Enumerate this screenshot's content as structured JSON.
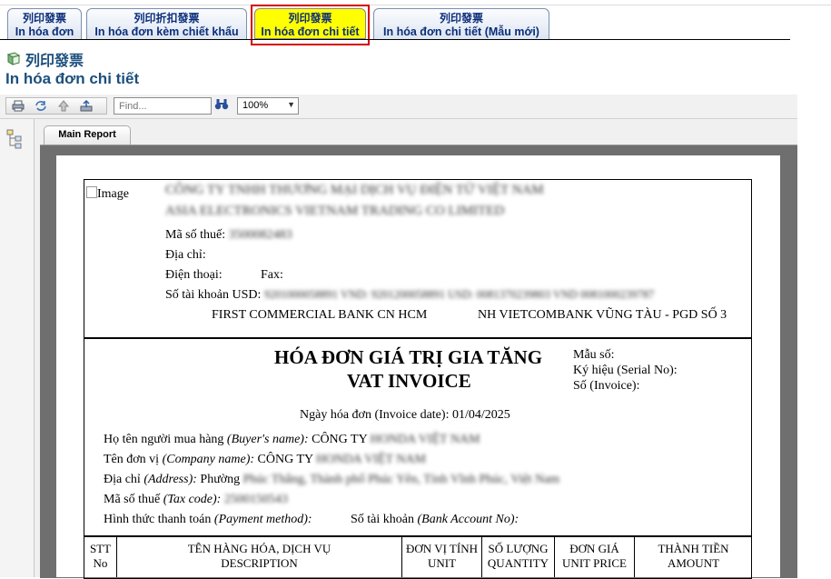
{
  "tabs": [
    {
      "cn": "列印發票",
      "vn": "In hóa đơn"
    },
    {
      "cn": "列印折扣發票",
      "vn": "In hóa đơn kèm chiết khấu"
    },
    {
      "cn": "列印發票",
      "vn": "In hóa đơn chi tiết"
    },
    {
      "cn": "列印發票",
      "vn": "In hóa đơn chi tiết (Mẫu mới)"
    }
  ],
  "page": {
    "title_cn": "列印發票",
    "title_vn": "In hóa đơn chi tiết"
  },
  "viewer": {
    "find_placeholder": "Find...",
    "zoom": "100%",
    "report_tab": "Main Report"
  },
  "invoice": {
    "image_alt": "Image",
    "company_name_line1": "CÔNG TY TNHH THƯƠNG MẠI DỊCH VỤ ĐIỆN TỬ VIỆT NAM",
    "company_name_line2": "ASIA ELECTRONICS VIETNAM TRADING CO LIMITED",
    "tax_label": "Mã số thuế:",
    "tax_value": "3500082483",
    "address_label": "Địa chỉ:",
    "phone_label": "Điện thoại:",
    "fax_label": "Fax:",
    "account_label": "Số tài khoản USD:",
    "account_value": "9201000058891 VND: 9201200058891 USD: 0081370239803 VND 0081000239787",
    "bank1": "FIRST COMMERCIAL BANK CN HCM",
    "bank2": "NH VIETCOMBANK VŨNG TÀU - PGD SỐ 3",
    "title_vn": "HÓA ĐƠN GIÁ TRỊ GIA TĂNG",
    "title_en": "VAT INVOICE",
    "form_no_label": "Mẫu số:",
    "serial_label": "Ký hiệu (Serial No):",
    "invoice_no_label": "Số (Invoice):",
    "date_line": "Ngày hóa đơn (Invoice date): 01/04/2025",
    "buyer_label_vn": "Họ tên người mua hàng ",
    "buyer_label_en": "(Buyer's name):",
    "buyer_value": "CÔNG TY ",
    "buyer_value_blur": "HONDA VIỆT NAM",
    "company_label_vn": "Tên đơn vị ",
    "company_label_en": "(Company name):",
    "company_value": "CÔNG TY ",
    "company_value_blur": "HONDA VIỆT NAM",
    "address2_label_vn": "Địa chỉ ",
    "address2_label_en": "(Address):",
    "address2_value": "Phường ",
    "address2_value_blur": "Phúc Thắng, Thành phố Phúc Yên, Tỉnh Vĩnh Phúc, Việt Nam",
    "taxcode_label_vn": "Mã số thuế ",
    "taxcode_label_en": "(Tax code):",
    "taxcode_value": "2500150543",
    "payment_label_vn": "Hình thức thanh toán ",
    "payment_label_en": "(Payment method):",
    "bank_acc_label_vn": "Số tài khoản ",
    "bank_acc_label_en": "(Bank Account No):",
    "columns": [
      {
        "l1": "STT",
        "l2": "No"
      },
      {
        "l1": "TÊN HÀNG HÓA, DỊCH VỤ",
        "l2": "DESCRIPTION"
      },
      {
        "l1": "ĐƠN VỊ TÍNH",
        "l2": "UNIT"
      },
      {
        "l1": "SỐ LƯỢNG",
        "l2": "QUANTITY"
      },
      {
        "l1": "ĐƠN GIÁ",
        "l2": "UNIT PRICE"
      },
      {
        "l1": "THÀNH TIỀN",
        "l2": "AMOUNT"
      }
    ]
  }
}
